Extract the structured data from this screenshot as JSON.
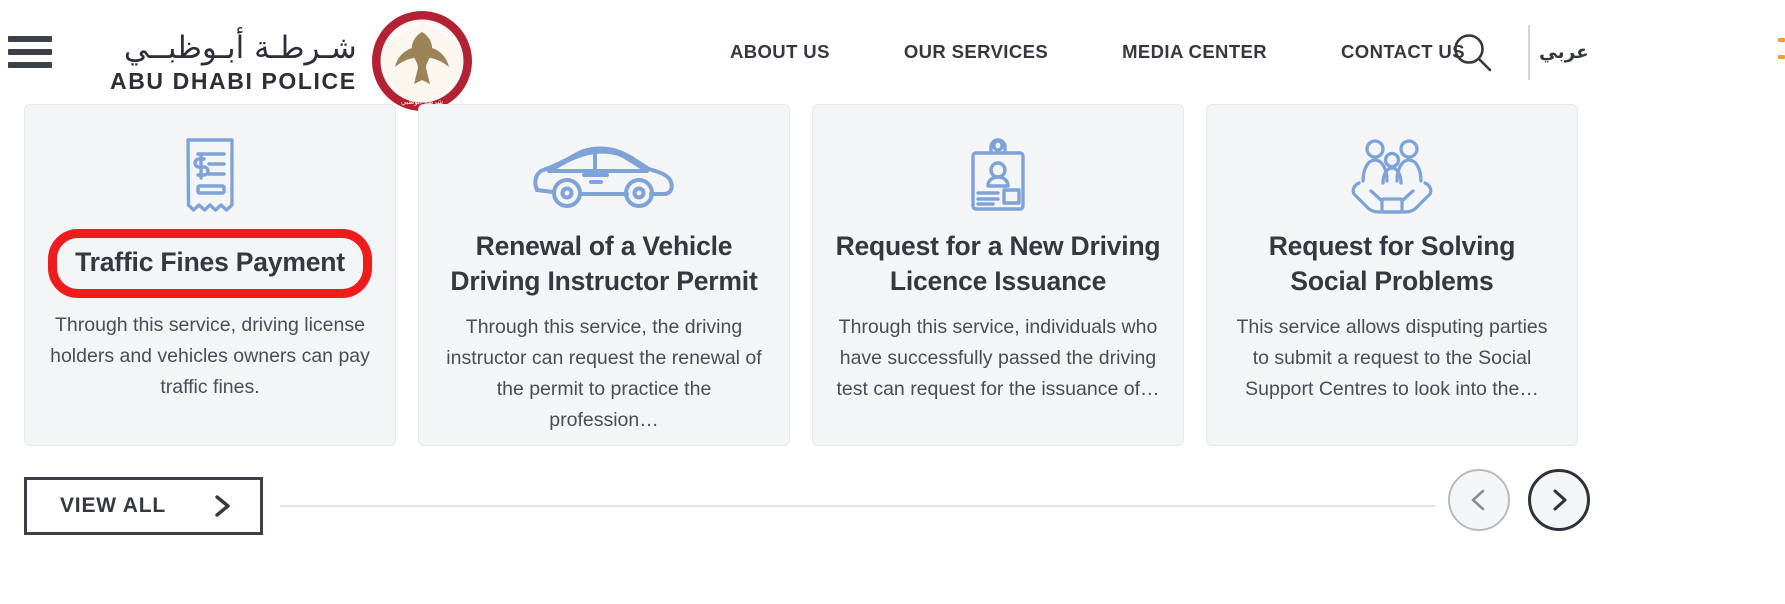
{
  "header": {
    "menu_icon": "hamburger-menu-icon",
    "brand": {
      "arabic": "شـرطـة أبـوظبــي",
      "english": "ABU DHABI POLICE",
      "crest_icon": "abu-dhabi-police-crest-icon"
    },
    "nav_items": [
      {
        "label": "ABOUT US"
      },
      {
        "label": "OUR SERVICES"
      },
      {
        "label": "MEDIA CENTER"
      },
      {
        "label": "CONTACT US"
      }
    ],
    "language_toggle": "عربي",
    "search_icon": "search-icon"
  },
  "services": {
    "cards": [
      {
        "icon": "receipt-invoice-icon",
        "title": "Traffic Fines Payment",
        "description": "Through this service, driving license holders and vehicles owners can pay traffic fines.",
        "highlighted": true,
        "highlight_color": "#ee1c1c"
      },
      {
        "icon": "car-icon",
        "title": "Renewal of a Vehicle Driving Instructor Permit",
        "description": "Through this service, the driving instructor can request the renewal of the permit to practice the profession…",
        "highlighted": false
      },
      {
        "icon": "id-badge-icon",
        "title": "Request for a New Driving Licence Issuance",
        "description": "Through this service, individuals who have successfully passed the driving test can request for the issuance of…",
        "highlighted": false
      },
      {
        "icon": "family-in-hands-icon",
        "title": "Request for Solving Social Problems",
        "description": "This service allows disputing parties to submit a request to the Social Support Centres to look into the…",
        "highlighted": false
      }
    ],
    "icon_color": "#7fa3d6"
  },
  "footer": {
    "view_all_label": "VIEW ALL",
    "view_all_icon": "chevron-right-icon",
    "prev_icon": "chevron-left-icon",
    "next_icon": "chevron-right-icon"
  }
}
